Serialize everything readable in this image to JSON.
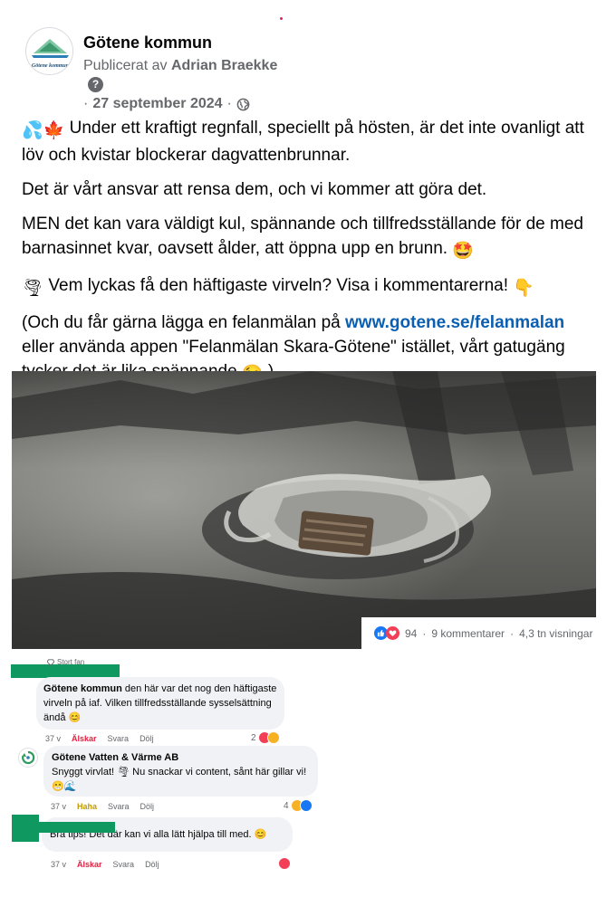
{
  "post": {
    "page_name": "Götene kommun",
    "logo_text": "Götene kommun",
    "published_prefix": "Publicerat av",
    "publisher": "Adrian Braekke",
    "help_icon": "?",
    "date_prefix": "·",
    "date": "27 september 2024",
    "date_sep": "·",
    "paragraphs": {
      "p1": "Under ett kraftigt regnfall, speciellt på hösten, är det inte ovanligt att löv och kvistar blockerar dagvattenbrunnar.",
      "p2": "Det är vårt ansvar att rensa dem, och vi kommer att göra det.",
      "p3": "MEN det kan vara väldigt kul, spännande och tillfredsställande för de med barnasinnet kvar, oavsett ålder, att öppna upp en brunn.",
      "p4": "Vem lyckas få den häftigaste virveln? Visa i kommentarerna!",
      "p5_start": "(Och du får gärna lägga en felanmälan på",
      "p5_link": "www.gotene.se/felanmalan",
      "p5_end": "eller använda appen \"Felanmälan Skara-Götene\" istället, vårt gatugäng tycker det är lika spännande",
      "p5_close": ")"
    },
    "emojis": {
      "droplets": "💦",
      "leaf": "🍁",
      "starstruck": "🤩",
      "tornado": "🌪",
      "point_down": "👇",
      "wink": "😉"
    }
  },
  "stats": {
    "reaction_count": "94",
    "comments": "9 kommentarer",
    "sep": "·",
    "views": "4,3 tn visningar"
  },
  "comments": [
    {
      "badge": "Stort fan",
      "author": "Götene kommun",
      "text": "den här var det nog den häftigaste virveln på iaf. Vilken tillfredsställande sysselsättning ändå",
      "emoji": "😊",
      "time": "37 v",
      "reaction": "Älskar",
      "reply": "Svara",
      "hide": "Dölj",
      "count": "2"
    },
    {
      "author": "Götene Vatten & Värme AB",
      "text": "Snyggt virvlat! 🌪 Nu snackar vi content, sånt här gillar vi!",
      "emoji": "😁🌊",
      "time": "37 v",
      "reaction": "Haha",
      "reply": "Svara",
      "hide": "Dölj",
      "count": "4"
    },
    {
      "author": "",
      "text": "Bra tips! Det där kan vi alla lätt hjälpa till med.",
      "emoji": "😊",
      "time": "37 v",
      "reaction": "Älskar",
      "reply": "Svara",
      "hide": "Dölj",
      "count": ""
    }
  ],
  "colors": {
    "link": "#0b5fb3",
    "like_blue": "#1877f2",
    "love_red": "#f33e58",
    "haha_yellow": "#f7b125",
    "redacted_green": "#0f9960"
  }
}
